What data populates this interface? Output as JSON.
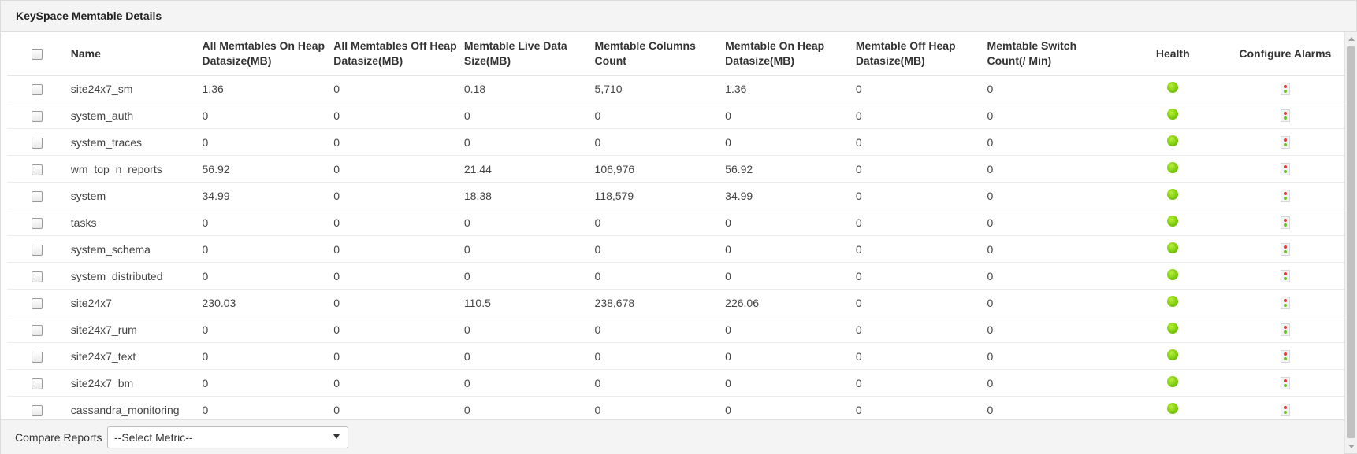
{
  "panel": {
    "title": "KeySpace Memtable Details"
  },
  "table": {
    "headers": {
      "name": "Name",
      "all_on_heap": "All Memtables On Heap Datasize(MB)",
      "all_off_heap": "All Memtables Off Heap Datasize(MB)",
      "live_data": "Memtable Live Data Size(MB)",
      "columns_count": "Memtable Columns Count",
      "on_heap": "Memtable On Heap Datasize(MB)",
      "off_heap": "Memtable Off Heap Datasize(MB)",
      "switch_count": "Memtable Switch Count(/ Min)",
      "health": "Health",
      "configure_alarms": "Configure Alarms"
    },
    "rows": [
      {
        "name": "site24x7_sm",
        "all_on_heap": "1.36",
        "all_off_heap": "0",
        "live_data": "0.18",
        "columns_count": "5,710",
        "on_heap": "1.36",
        "off_heap": "0",
        "switch_count": "0"
      },
      {
        "name": "system_auth",
        "all_on_heap": "0",
        "all_off_heap": "0",
        "live_data": "0",
        "columns_count": "0",
        "on_heap": "0",
        "off_heap": "0",
        "switch_count": "0"
      },
      {
        "name": "system_traces",
        "all_on_heap": "0",
        "all_off_heap": "0",
        "live_data": "0",
        "columns_count": "0",
        "on_heap": "0",
        "off_heap": "0",
        "switch_count": "0"
      },
      {
        "name": "wm_top_n_reports",
        "all_on_heap": "56.92",
        "all_off_heap": "0",
        "live_data": "21.44",
        "columns_count": "106,976",
        "on_heap": "56.92",
        "off_heap": "0",
        "switch_count": "0"
      },
      {
        "name": "system",
        "all_on_heap": "34.99",
        "all_off_heap": "0",
        "live_data": "18.38",
        "columns_count": "118,579",
        "on_heap": "34.99",
        "off_heap": "0",
        "switch_count": "0"
      },
      {
        "name": "tasks",
        "all_on_heap": "0",
        "all_off_heap": "0",
        "live_data": "0",
        "columns_count": "0",
        "on_heap": "0",
        "off_heap": "0",
        "switch_count": "0"
      },
      {
        "name": "system_schema",
        "all_on_heap": "0",
        "all_off_heap": "0",
        "live_data": "0",
        "columns_count": "0",
        "on_heap": "0",
        "off_heap": "0",
        "switch_count": "0"
      },
      {
        "name": "system_distributed",
        "all_on_heap": "0",
        "all_off_heap": "0",
        "live_data": "0",
        "columns_count": "0",
        "on_heap": "0",
        "off_heap": "0",
        "switch_count": "0"
      },
      {
        "name": "site24x7",
        "all_on_heap": "230.03",
        "all_off_heap": "0",
        "live_data": "110.5",
        "columns_count": "238,678",
        "on_heap": "226.06",
        "off_heap": "0",
        "switch_count": "0"
      },
      {
        "name": "site24x7_rum",
        "all_on_heap": "0",
        "all_off_heap": "0",
        "live_data": "0",
        "columns_count": "0",
        "on_heap": "0",
        "off_heap": "0",
        "switch_count": "0"
      },
      {
        "name": "site24x7_text",
        "all_on_heap": "0",
        "all_off_heap": "0",
        "live_data": "0",
        "columns_count": "0",
        "on_heap": "0",
        "off_heap": "0",
        "switch_count": "0"
      },
      {
        "name": "site24x7_bm",
        "all_on_heap": "0",
        "all_off_heap": "0",
        "live_data": "0",
        "columns_count": "0",
        "on_heap": "0",
        "off_heap": "0",
        "switch_count": "0"
      },
      {
        "name": "cassandra_monitoring",
        "all_on_heap": "0",
        "all_off_heap": "0",
        "live_data": "0",
        "columns_count": "0",
        "on_heap": "0",
        "off_heap": "0",
        "switch_count": "0"
      }
    ]
  },
  "footer": {
    "compare_label": "Compare Reports",
    "select_value": "--Select Metric--"
  },
  "icons": {
    "health": "health-status-icon",
    "alarm": "configure-alarm-icon",
    "dropdown": "chevron-down-icon"
  },
  "colors": {
    "health_ok": "#7fcc10",
    "alarm_red": "#e03a3a",
    "alarm_green": "#6cbf2a"
  }
}
